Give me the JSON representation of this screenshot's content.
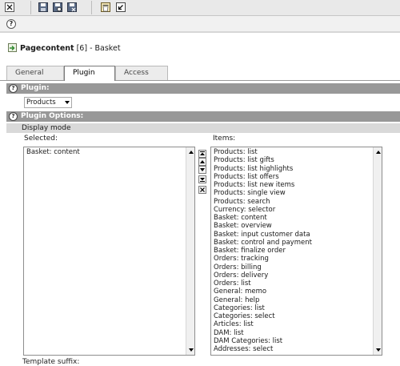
{
  "toolbar": {
    "icons": [
      "close-icon",
      "save-icon",
      "save-and-view-icon",
      "save-and-close-icon",
      "delete-icon",
      "undo-icon"
    ]
  },
  "help": {
    "symbol": "?"
  },
  "header": {
    "title_bold": "Pagecontent",
    "title_rest": " [6] - Basket"
  },
  "tabs": [
    {
      "label": "General"
    },
    {
      "label": "Plugin"
    },
    {
      "label": "Access"
    }
  ],
  "sections": {
    "plugin": {
      "label": "Plugin:"
    },
    "plugin_options": {
      "label": "Plugin Options:"
    }
  },
  "plugin_select": {
    "value": "Products"
  },
  "display_mode": {
    "label": "Display mode",
    "selected_label": "Selected:",
    "items_label": "Items:",
    "selected": [
      "Basket: content"
    ],
    "items": [
      "Products: list",
      "Products: list gifts",
      "Products: list highlights",
      "Products: list offers",
      "Products: list new items",
      "Products: single view",
      "Products: search",
      "Currency: selector",
      "Basket: content",
      "Basket: overview",
      "Basket: input customer data",
      "Basket: control and payment",
      "Basket: finalize order",
      "Orders: tracking",
      "Orders: billing",
      "Orders: delivery",
      "Orders: list",
      "General: memo",
      "General: help",
      "Categories: list",
      "Categories: select",
      "Articles: list",
      "DAM: list",
      "DAM Categories: list",
      "Addresses: select"
    ]
  },
  "bottom": {
    "label": "Template suffix:"
  },
  "colors": {
    "section_bar": "#989898",
    "toolbar": "#e9e9e9"
  }
}
